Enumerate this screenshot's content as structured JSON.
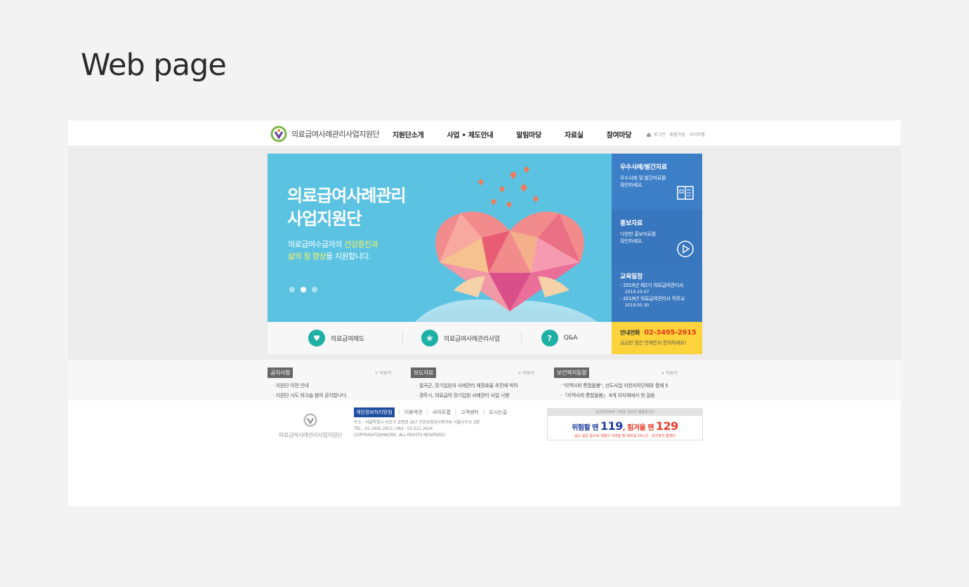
{
  "page_heading": "Web page",
  "header": {
    "logo_text": "의료급여사례관리사업지원단",
    "nav": [
      "지원단소개",
      "사업 • 제도안내",
      "알림마당",
      "자료실",
      "참여마당"
    ],
    "util": [
      "로그인",
      "회원가입",
      "사이트맵"
    ]
  },
  "hero": {
    "title_line1": "의료급여사례관리",
    "title_line2": "사업지원단",
    "sub_line1_pre": "의료급여수급자의 ",
    "sub_line1_hl": "건강증진과",
    "sub_line2_hl": "삶의 질 향상",
    "sub_line2_post": "을 지원합니다.",
    "slide_count": 3,
    "active_slide": 2
  },
  "quick_links": [
    {
      "label": "의료급여제도",
      "icon": "heart-icon"
    },
    {
      "label": "의료급여사례관리사업",
      "icon": "leaf-icon"
    },
    {
      "label": "Q&A",
      "icon": "question-icon"
    }
  ],
  "side": {
    "box1_title": "우수사례/발간자료",
    "box1_desc1": "우수사례 및 발간자료를",
    "box1_desc2": "확인하세요.",
    "box2_title": "홍보자료",
    "box2_desc1": "다양한 홍보자료를",
    "box2_desc2": "확인하세요.",
    "box3_title": "교육일정",
    "edu1": "- 2019년 제2기 의료급여관리사",
    "edu1_date": "2019.10.07",
    "edu2": "- 2019년 의료급여관리사 직무교",
    "edu2_date": "2019.05.30",
    "phone_label": "안내전화",
    "phone": "02-3495-2915",
    "phone_desc": "궁금한 점은 언제든지 문의하세요!"
  },
  "boards": [
    {
      "tag": "공지사항",
      "more": "+ 더보기",
      "items": [
        "지원단 이전 안내",
        "지원단 시도 워크숍 참여 공지합니다."
      ]
    },
    {
      "tag": "보도자료",
      "more": "+ 더보기",
      "items": [
        "칠곡군, 장기입원자 사례관리 재정효율 추진에 박차",
        "경주시, 의료급여 장기입원 사례관리 사업 시행"
      ]
    },
    {
      "tag": "보건복지동향",
      "more": "+ 더보기",
      "items": [
        "\"지역사회 통합돌봄\", 선도사업 지방자치단체와 함께 5",
        "『지역사회 통합돌봄』 8개 지자체에서 첫 걸음"
      ]
    }
  ],
  "footer": {
    "logo_text": "의료급여사례관리사업지원단",
    "links": [
      "개인정보처리방침",
      "이용약관",
      "사이트맵",
      "고객센터",
      "오시는길"
    ],
    "address": "주소 : 서울특별시 서초구 효령로 267 건강보험심사평가원 서울사무소 3층",
    "tel": "TEL : 02.3495.2915 / FAX : 02.521.2624",
    "copyright": "COPYRIGHT@MACMC. ALL RIGHTS RESERVED.",
    "banner_top": "보건복지부와 가까운 상담과 해결입니다",
    "banner_pre": "위험할 땐 ",
    "banner_num1": "119",
    "banner_mid": ", 힘겨울 땐 ",
    "banner_num2": "129",
    "banner_sub": "살도 힘든 등으로 생활이 어려울 땐 365일 24시간 · 보건복지 콜센터"
  },
  "colors": {
    "hero_bg": "#5bc3e1",
    "side_blue": "#3d7fc7",
    "side_yellow": "#fcd33a",
    "quick_icon": "#1eafa5",
    "phone_red": "#e8391c"
  }
}
